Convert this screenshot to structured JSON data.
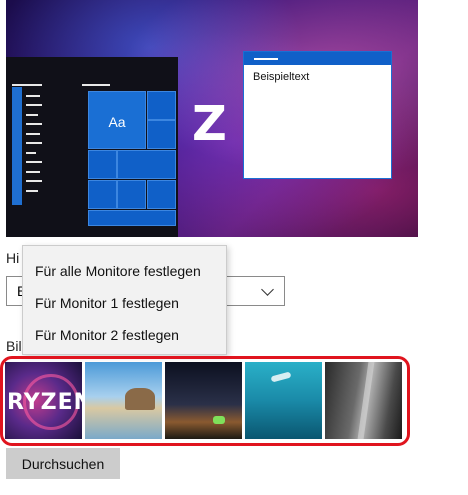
{
  "preview": {
    "sample_text": "Beispieltext",
    "tile_text": "Aa",
    "logo_letter": "Z"
  },
  "background_label": "Hi",
  "select": {
    "value": "B"
  },
  "pictures_label": "Bil",
  "context_menu": {
    "items": [
      "Für alle Monitore festlegen",
      "Für Monitor 1 festlegen",
      "Für Monitor 2 festlegen"
    ]
  },
  "thumbnails": [
    {
      "name": "ryzen",
      "text": "RYZEN"
    },
    {
      "name": "beach"
    },
    {
      "name": "night-sky"
    },
    {
      "name": "underwater"
    },
    {
      "name": "rock-cliff"
    }
  ],
  "highlight_color": "#e0141e",
  "browse_button": "Durchsuchen"
}
